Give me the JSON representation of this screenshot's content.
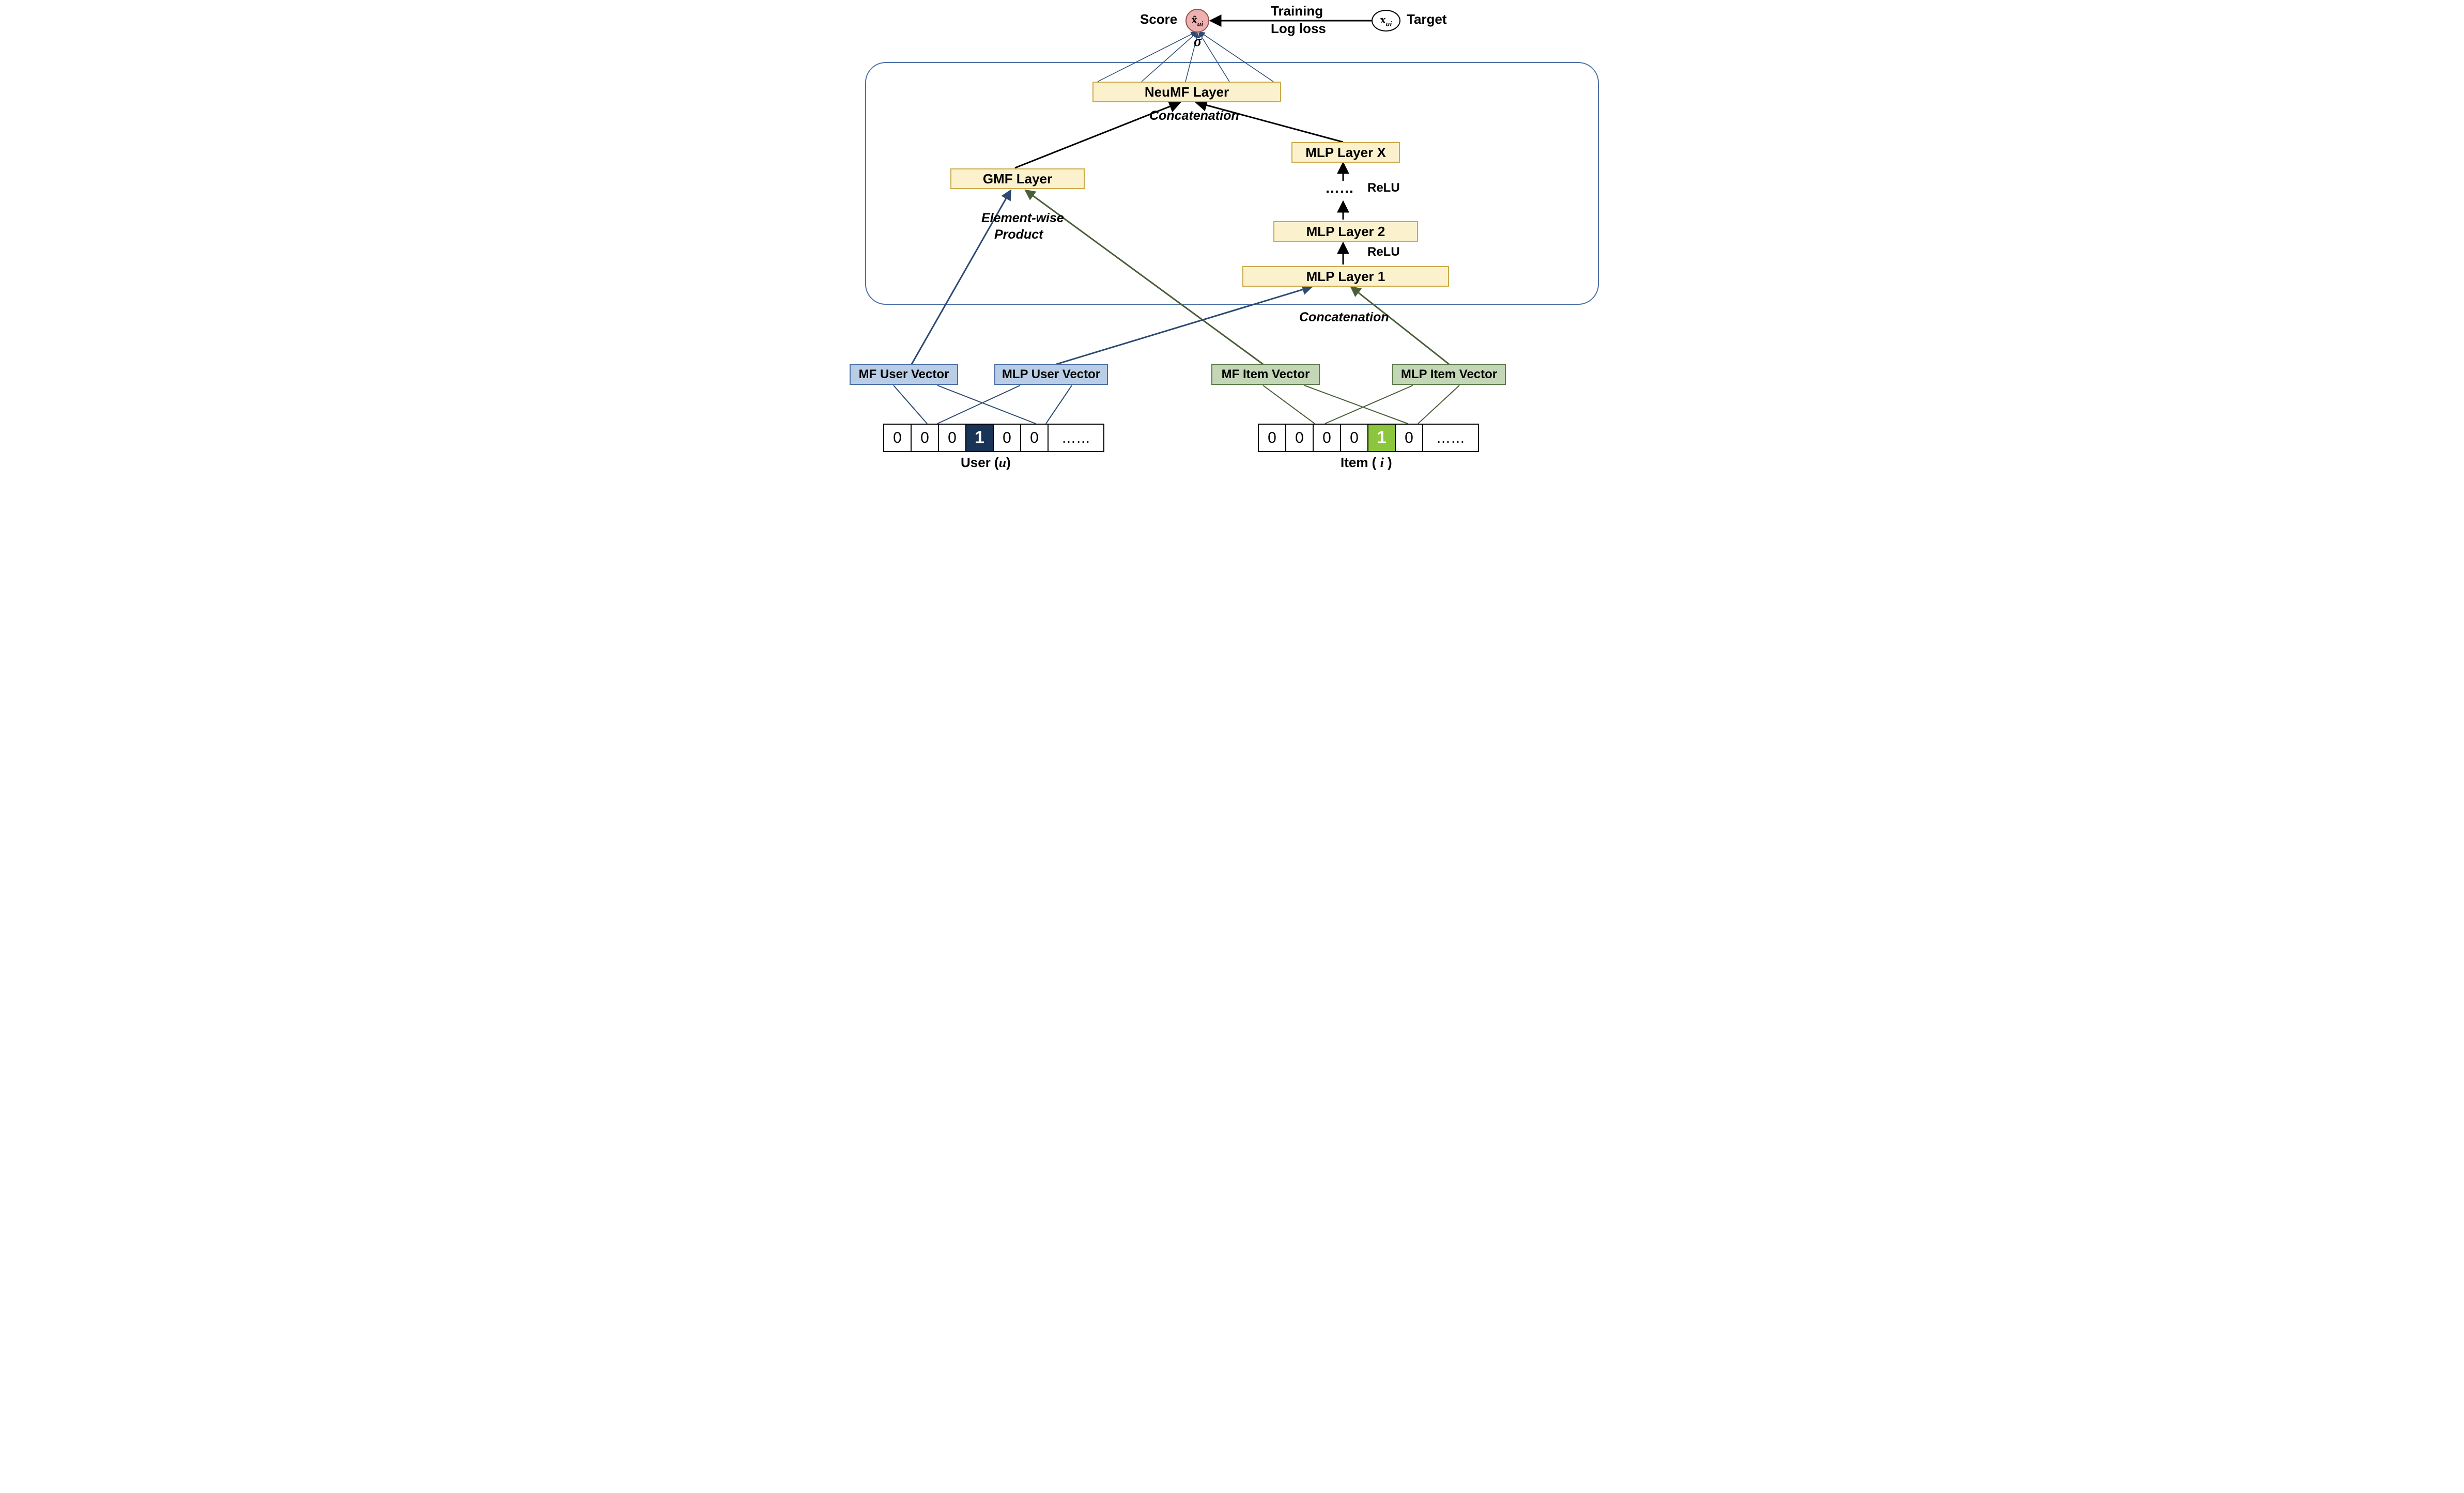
{
  "top": {
    "score_label": "Score",
    "score_symbol": "x̂",
    "score_sub": "ui",
    "sigma": "σ",
    "training_line1": "Training",
    "training_line2": "Log loss",
    "target_symbol": "x",
    "target_sub": "ui",
    "target_label": "Target"
  },
  "layers": {
    "neumf": "NeuMF Layer",
    "concat_top": "Concatenation",
    "gmf": "GMF Layer",
    "ewp_line1": "Element-wise",
    "ewp_line2": "Product",
    "mlp_x": "MLP Layer X",
    "mlp_dots": "……",
    "relu1": "ReLU",
    "mlp_2": "MLP Layer 2",
    "relu2": "ReLU",
    "mlp_1": "MLP Layer 1",
    "concat_bottom": "Concatenation"
  },
  "vectors": {
    "mf_user": "MF User Vector",
    "mlp_user": "MLP User Vector",
    "mf_item": "MF Item Vector",
    "mlp_item": "MLP Item Vector"
  },
  "onehot": {
    "user": {
      "cells": [
        "0",
        "0",
        "0",
        "1",
        "0",
        "0",
        "……"
      ],
      "active_index": 3,
      "label_prefix": "User (",
      "label_var": "u",
      "label_suffix": ")"
    },
    "item": {
      "cells": [
        "0",
        "0",
        "0",
        "0",
        "1",
        "0",
        "……"
      ],
      "active_index": 4,
      "label_prefix": "Item ( ",
      "label_var": "i",
      "label_suffix": " )"
    }
  }
}
